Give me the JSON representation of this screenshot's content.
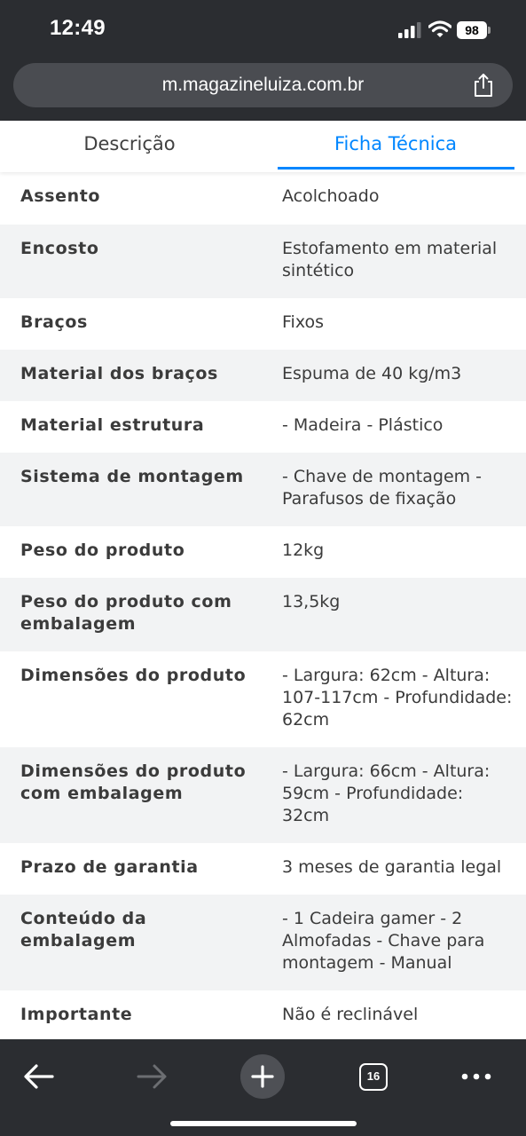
{
  "status_bar": {
    "time": "12:49",
    "battery": "98",
    "icons": [
      "signal-icon",
      "wifi-icon",
      "battery-icon"
    ]
  },
  "browser": {
    "url": "m.magazineluiza.com.br",
    "share_icon": "share-icon"
  },
  "tabs": [
    {
      "label": "Descrição",
      "active": false
    },
    {
      "label": "Ficha Técnica",
      "active": true
    }
  ],
  "accent_color": "#0086ff",
  "specs": [
    {
      "label": "Assento",
      "value": "Acolchoado"
    },
    {
      "label": "Encosto",
      "value": "Estofamento em material sintético"
    },
    {
      "label": "Braços",
      "value": "Fixos"
    },
    {
      "label": "Material dos braços",
      "value": "Espuma de 40 kg/m3"
    },
    {
      "label": "Material estrutura",
      "value": "- Madeira - Plástico"
    },
    {
      "label": "Sistema de montagem",
      "value": "- Chave de montagem - Parafusos de fixação"
    },
    {
      "label": "Peso do produto",
      "value": "12kg"
    },
    {
      "label": "Peso do produto com embalagem",
      "value": "13,5kg"
    },
    {
      "label": "Dimensões do produto",
      "value": "- Largura: 62cm - Altura: 107-117cm - Profundidade: 62cm"
    },
    {
      "label": "Dimensões do produto com embalagem",
      "value": "- Largura: 66cm - Altura: 59cm - Profundidade: 32cm"
    },
    {
      "label": "Prazo de garantia",
      "value": "3 meses de garantia legal"
    },
    {
      "label": "Conteúdo da embalagem",
      "value": "- 1 Cadeira gamer - 2 Almofadas - Chave para montagem - Manual"
    },
    {
      "label": "Importante",
      "value": "Não é reclinável"
    }
  ],
  "toolbar": {
    "tab_count": "16",
    "icons": [
      "back-arrow-icon",
      "forward-arrow-icon",
      "plus-icon",
      "tabs-icon",
      "more-icon"
    ]
  }
}
